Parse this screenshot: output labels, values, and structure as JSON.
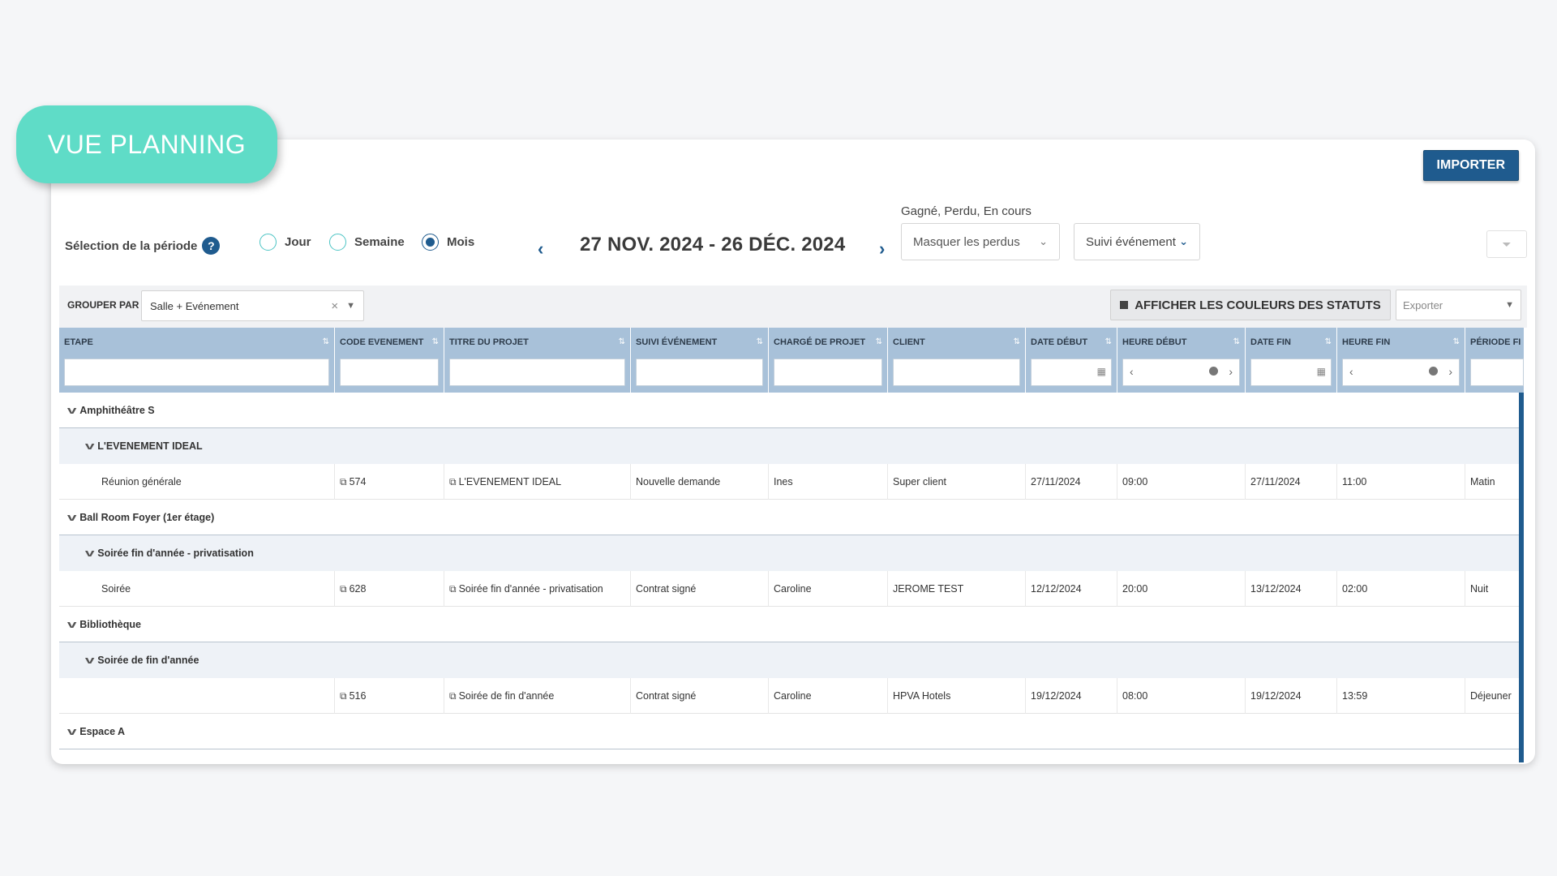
{
  "badge": "VUE PLANNING",
  "header": {
    "import_label": "IMPORTER"
  },
  "period": {
    "label": "Sélection de la période",
    "help": "?",
    "options": [
      "Jour",
      "Semaine",
      "Mois"
    ],
    "selected": "Mois",
    "prev": "‹",
    "next": "›",
    "range": "27 NOV. 2024 - 26 DÉC. 2024"
  },
  "filters": {
    "status_caption": "Gagné, Perdu, En cours",
    "hide_lost": "Masquer les perdus",
    "follow": "Suivi événement"
  },
  "toolbar": {
    "group_label": "GROUPER PAR",
    "group_value": "Salle + Evénement",
    "colors_label": "AFFICHER LES COULEURS DES STATUTS",
    "export_placeholder": "Exporter"
  },
  "columns": [
    "ETAPE",
    "CODE EVENEMENT",
    "TITRE DU PROJET",
    "SUIVI ÉVÉNEMENT",
    "CHARGÉ DE PROJET",
    "CLIENT",
    "DATE DÉBUT",
    "HEURE DÉBUT",
    "DATE FIN",
    "HEURE FIN",
    "PÉRIODE FI"
  ],
  "groups": [
    {
      "room": "Amphithéâtre S",
      "event": "L'EVENEMENT IDEAL",
      "row": {
        "etape": "Réunion générale",
        "code": "574",
        "titre": "L'EVENEMENT IDEAL",
        "suivi": "Nouvelle demande",
        "charge": "Ines",
        "client": "Super client",
        "date_debut": "27/11/2024",
        "heure_debut": "09:00",
        "date_fin": "27/11/2024",
        "heure_fin": "11:00",
        "periode": "Matin"
      }
    },
    {
      "room": "Ball Room Foyer (1er étage)",
      "event": "Soirée fin d'année - privatisation",
      "row": {
        "etape": "Soirée",
        "code": "628",
        "titre": "Soirée fin d'année - privatisation",
        "suivi": "Contrat signé",
        "charge": "Caroline",
        "client": "JEROME TEST",
        "date_debut": "12/12/2024",
        "heure_debut": "20:00",
        "date_fin": "13/12/2024",
        "heure_fin": "02:00",
        "periode": "Nuit"
      }
    },
    {
      "room": "Bibliothèque",
      "event": "Soirée de fin d'année",
      "row": {
        "etape": "",
        "code": "516",
        "titre": "Soirée de fin d'année",
        "suivi": "Contrat signé",
        "charge": "Caroline",
        "client": "HPVA Hotels",
        "date_debut": "19/12/2024",
        "heure_debut": "08:00",
        "date_fin": "19/12/2024",
        "heure_fin": "13:59",
        "periode": "Déjeuner"
      }
    },
    {
      "room": "Espace A"
    }
  ],
  "colors": {
    "accent": "#1f5b8e",
    "badge": "#5fdcc7",
    "header_bg": "#a8c1d9"
  }
}
